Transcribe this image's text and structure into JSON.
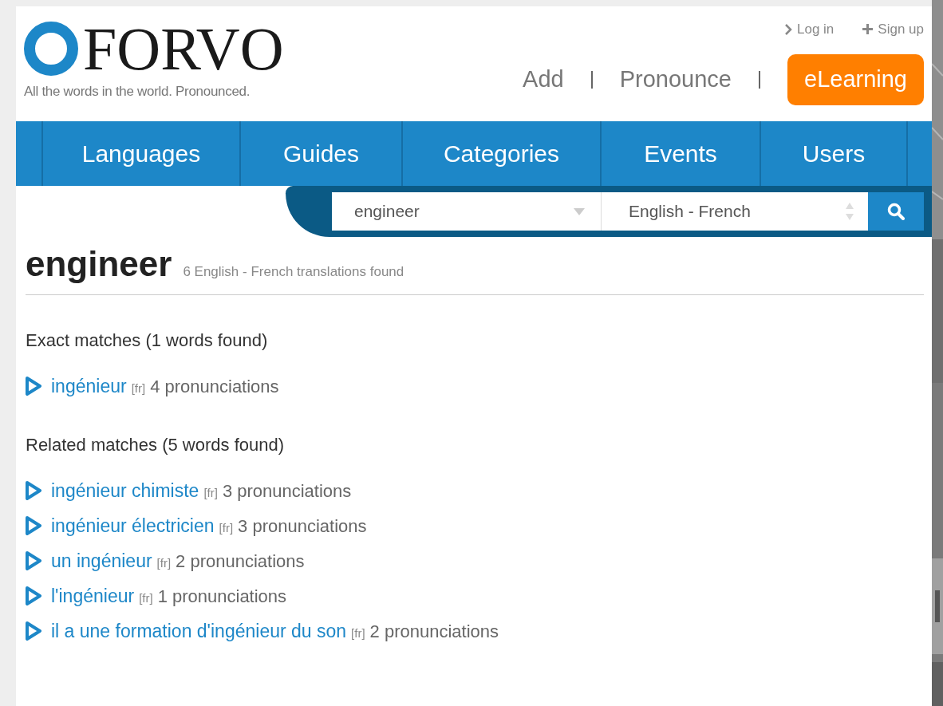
{
  "header": {
    "logo_text": "FORVO",
    "tagline": "All the words in the world. Pronounced.",
    "account_links": [
      {
        "kind": "login",
        "label": "Log in"
      },
      {
        "kind": "signup",
        "label": "Sign up"
      }
    ],
    "nav_links": [
      "Add",
      "Pronounce"
    ],
    "elearning_button": "eLearning"
  },
  "main_nav": [
    "Languages",
    "Guides",
    "Categories",
    "Events",
    "Users"
  ],
  "search": {
    "query": "engineer",
    "language_pair": "English - French"
  },
  "result": {
    "word": "engineer",
    "summary": "6 English - French translations found"
  },
  "sections": [
    {
      "heading": "Exact matches (1 words found)",
      "items": [
        {
          "word": "ingénieur",
          "lang": "[fr]",
          "count": "4 pronunciations"
        }
      ]
    },
    {
      "heading": "Related matches (5 words found)",
      "items": [
        {
          "word": "ingénieur chimiste",
          "lang": "[fr]",
          "count": "3 pronunciations"
        },
        {
          "word": "ingénieur électricien",
          "lang": "[fr]",
          "count": "3 pronunciations"
        },
        {
          "word": "un ingénieur",
          "lang": "[fr]",
          "count": "2 pronunciations"
        },
        {
          "word": "l'ingénieur",
          "lang": "[fr]",
          "count": "1 pronunciations"
        },
        {
          "word": "il a une formation d'ingénieur du son",
          "lang": "[fr]",
          "count": "2 pronunciations"
        }
      ]
    }
  ]
}
